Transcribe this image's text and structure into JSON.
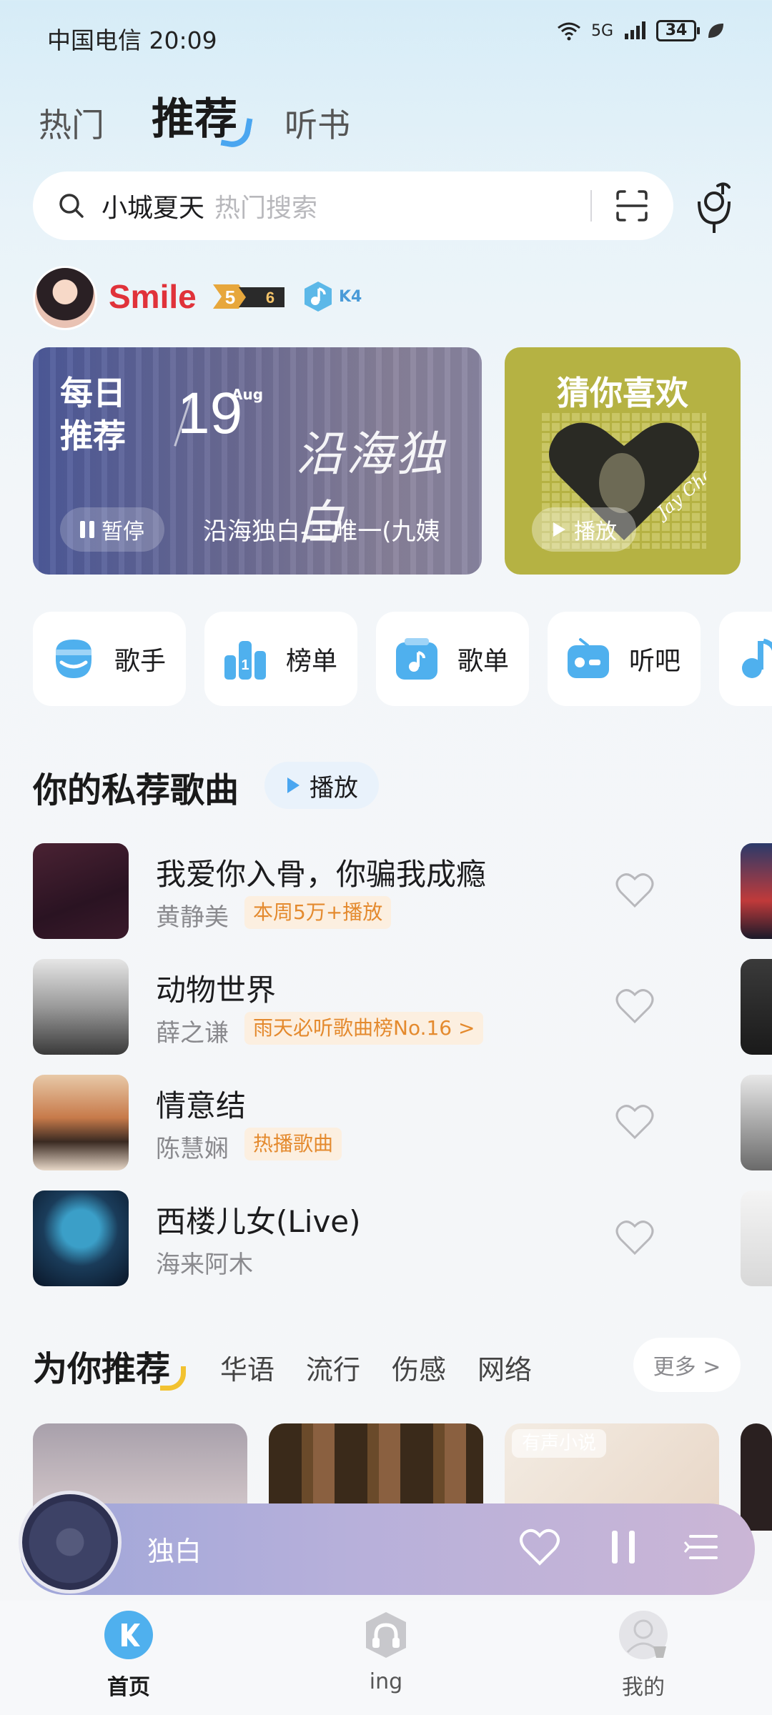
{
  "status": {
    "carrier_time": "中国电信 20:09",
    "battery": "34",
    "network": "5G"
  },
  "tabs": [
    "热门",
    "推荐",
    "听书"
  ],
  "search": {
    "query": "小城夏天",
    "placeholder": "热门搜索"
  },
  "user": {
    "name": "Smile",
    "level": "5",
    "sublevel": "6",
    "k_level": "K4"
  },
  "daily": {
    "title": "每日推荐",
    "day": "19",
    "month": "Aug",
    "calligraphy": "沿海独白",
    "pause_label": "暂停",
    "song": "沿海独白-王唯一(九姨"
  },
  "guess": {
    "title": "猜你喜欢",
    "play_label": "播放"
  },
  "shortcuts": [
    {
      "label": "歌手",
      "icon": "singer-icon"
    },
    {
      "label": "榜单",
      "icon": "chart-icon"
    },
    {
      "label": "歌单",
      "icon": "playlist-icon"
    },
    {
      "label": "听吧",
      "icon": "radio-icon"
    }
  ],
  "private_songs": {
    "title": "你的私荐歌曲",
    "play_label": "播放",
    "items": [
      {
        "title": "我爱你入骨，你骗我成瘾",
        "artist": "黄静美",
        "tag": "本周5万+播放"
      },
      {
        "title": "动物世界",
        "artist": "薛之谦",
        "tag": "雨天必听歌曲榜No.16 >"
      },
      {
        "title": "情意结",
        "artist": "陈慧娴",
        "tag": "热播歌曲"
      },
      {
        "title": "西楼儿女(Live)",
        "artist": "海来阿木",
        "tag": ""
      }
    ]
  },
  "recommend": {
    "title": "为你推荐",
    "categories": [
      "华语",
      "流行",
      "伤感",
      "网络"
    ],
    "more_label": "更多 >",
    "audiobook_tag": "有声小说"
  },
  "mini_player": {
    "title": "独白"
  },
  "nav": [
    {
      "label": "首页",
      "icon": "home-icon"
    },
    {
      "label": "ing",
      "icon": "headphones-icon"
    },
    {
      "label": "我的",
      "icon": "profile-icon"
    }
  ],
  "colors": {
    "accent": "#4aa6f0",
    "username": "#e0323a",
    "tag": "#e48a2e"
  }
}
